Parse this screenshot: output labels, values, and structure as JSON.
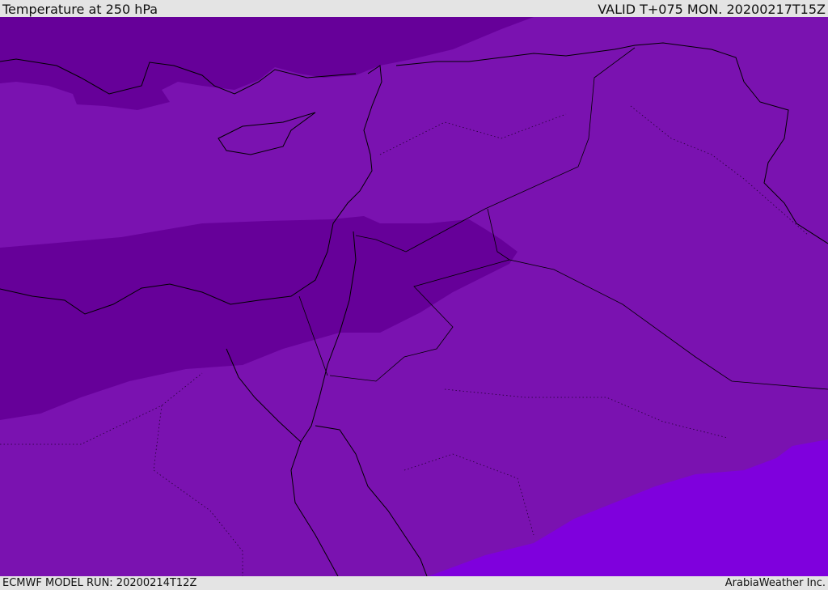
{
  "header": {
    "title": "Temperature at 250 hPa",
    "valid": "VALID T+075 MON. 20200217T15Z"
  },
  "footer": {
    "model_run": "ECMWF MODEL RUN: 20200214T12Z",
    "credit": "ArabiaWeather Inc."
  },
  "colors": {
    "cold_band": "#660099",
    "mid": "#7a12b0",
    "warm": "#7f00dd",
    "coast": "#000000"
  }
}
